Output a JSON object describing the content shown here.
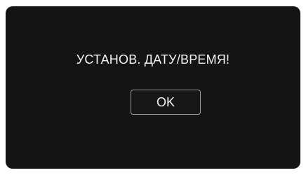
{
  "dialog": {
    "message": "УСТАНОВ. ДАТУ/ВРЕМЯ!",
    "ok_label": "OK"
  },
  "colors": {
    "screen_background": "#141414",
    "text": "#f2f2f2",
    "button_border": "#9a9a9a"
  }
}
